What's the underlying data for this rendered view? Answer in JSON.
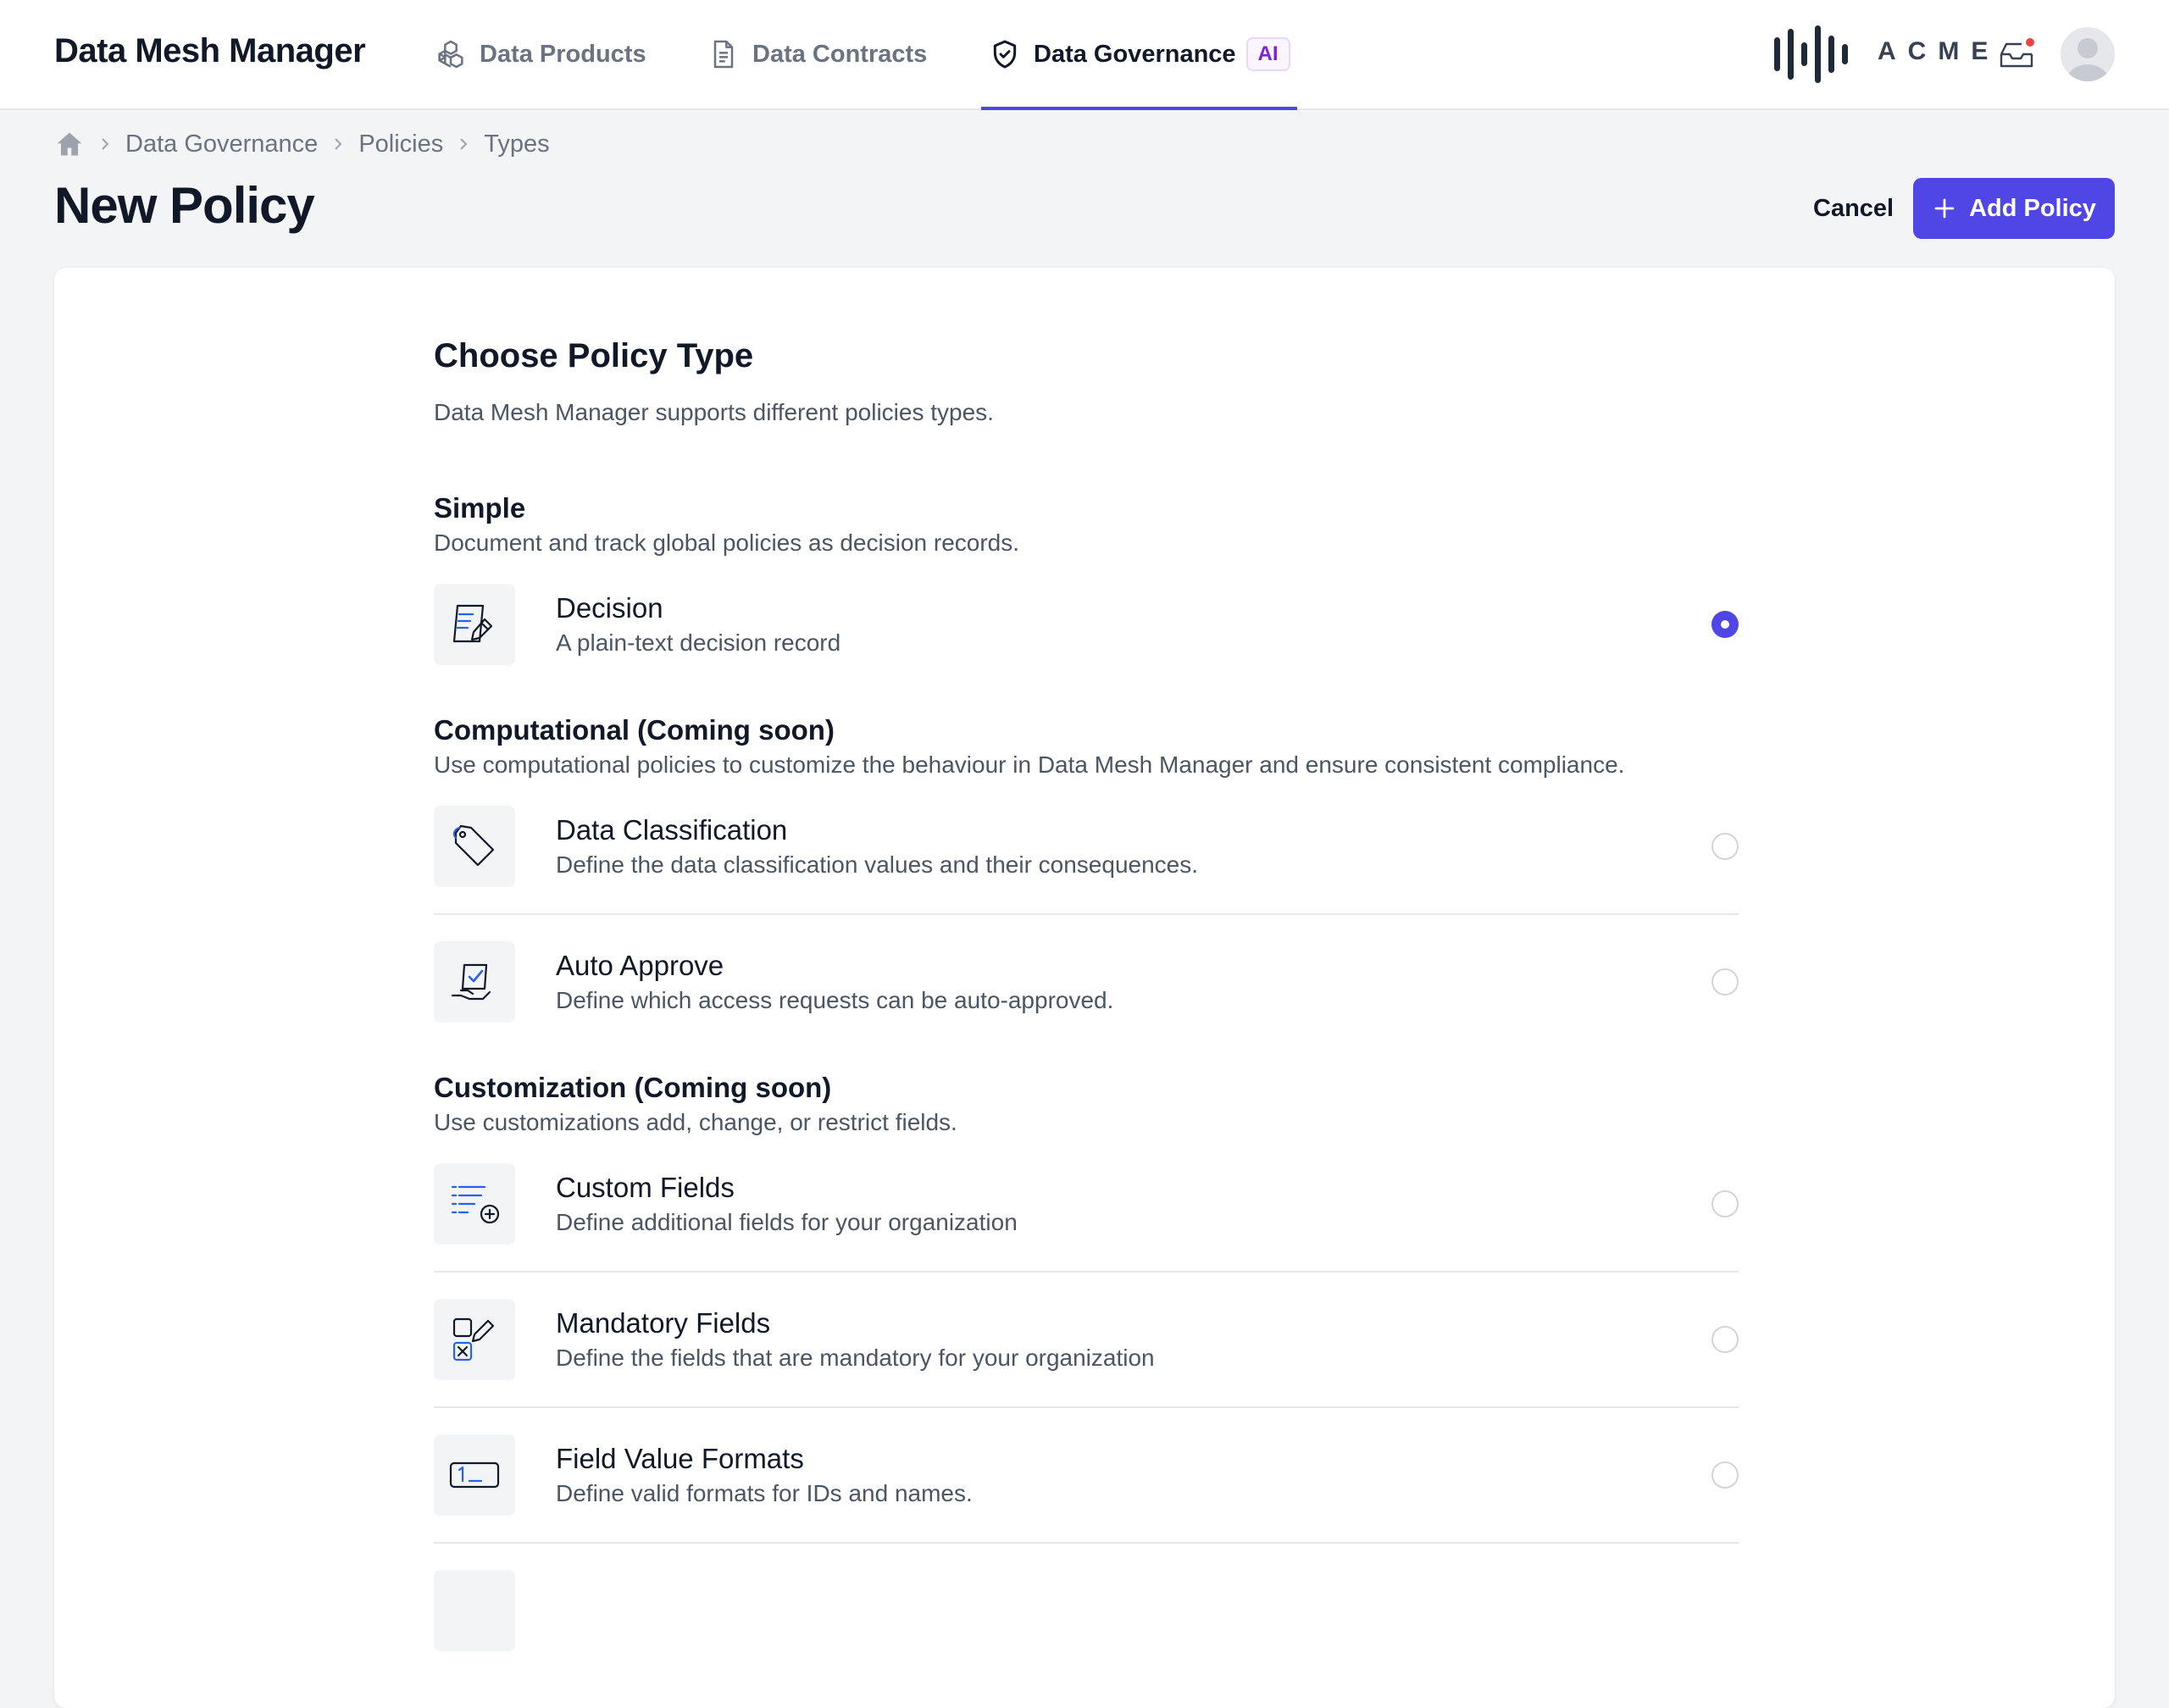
{
  "app": {
    "title": "Data Mesh Manager",
    "brand": "ACME"
  },
  "nav": {
    "tabs": [
      {
        "label": "Data Products",
        "icon": "cubes-icon",
        "active": false
      },
      {
        "label": "Data Contracts",
        "icon": "document-icon",
        "active": false
      },
      {
        "label": "Data Governance",
        "icon": "shield-icon",
        "active": true,
        "badge": "AI"
      }
    ]
  },
  "breadcrumb": {
    "items": [
      "Data Governance",
      "Policies",
      "Types"
    ]
  },
  "page": {
    "title": "New Policy"
  },
  "actions": {
    "cancel_label": "Cancel",
    "add_label": "Add Policy"
  },
  "form": {
    "heading": "Choose Policy Type",
    "description": "Data Mesh Manager supports different policies types.",
    "sections": [
      {
        "title": "Simple",
        "description": "Document and track global policies as decision records.",
        "options": [
          {
            "title": "Decision",
            "description": "A plain-text decision record",
            "icon": "decision-record-icon",
            "selected": true
          }
        ]
      },
      {
        "title": "Computational (Coming soon)",
        "description": "Use computational policies to customize the behaviour in Data Mesh Manager and ensure consistent compliance.",
        "options": [
          {
            "title": "Data Classification",
            "description": "Define the data classification values and their consequences.",
            "icon": "tag-icon",
            "selected": false
          },
          {
            "title": "Auto Approve",
            "description": "Define which access requests can be auto-approved.",
            "icon": "hand-check-icon",
            "selected": false
          }
        ]
      },
      {
        "title": "Customization (Coming soon)",
        "description": "Use customizations add, change, or restrict fields.",
        "options": [
          {
            "title": "Custom Fields",
            "description": "Define additional fields for your organization",
            "icon": "list-plus-icon",
            "selected": false
          },
          {
            "title": "Mandatory Fields",
            "description": "Define the fields that are mandatory for your organization",
            "icon": "checkbox-pencil-icon",
            "selected": false
          },
          {
            "title": "Field Value Formats",
            "description": "Define valid formats for IDs and names.",
            "icon": "input-format-icon",
            "selected": false
          }
        ]
      }
    ]
  },
  "colors": {
    "accent": "#4f46e5",
    "ai_badge": "#7e22ce"
  }
}
